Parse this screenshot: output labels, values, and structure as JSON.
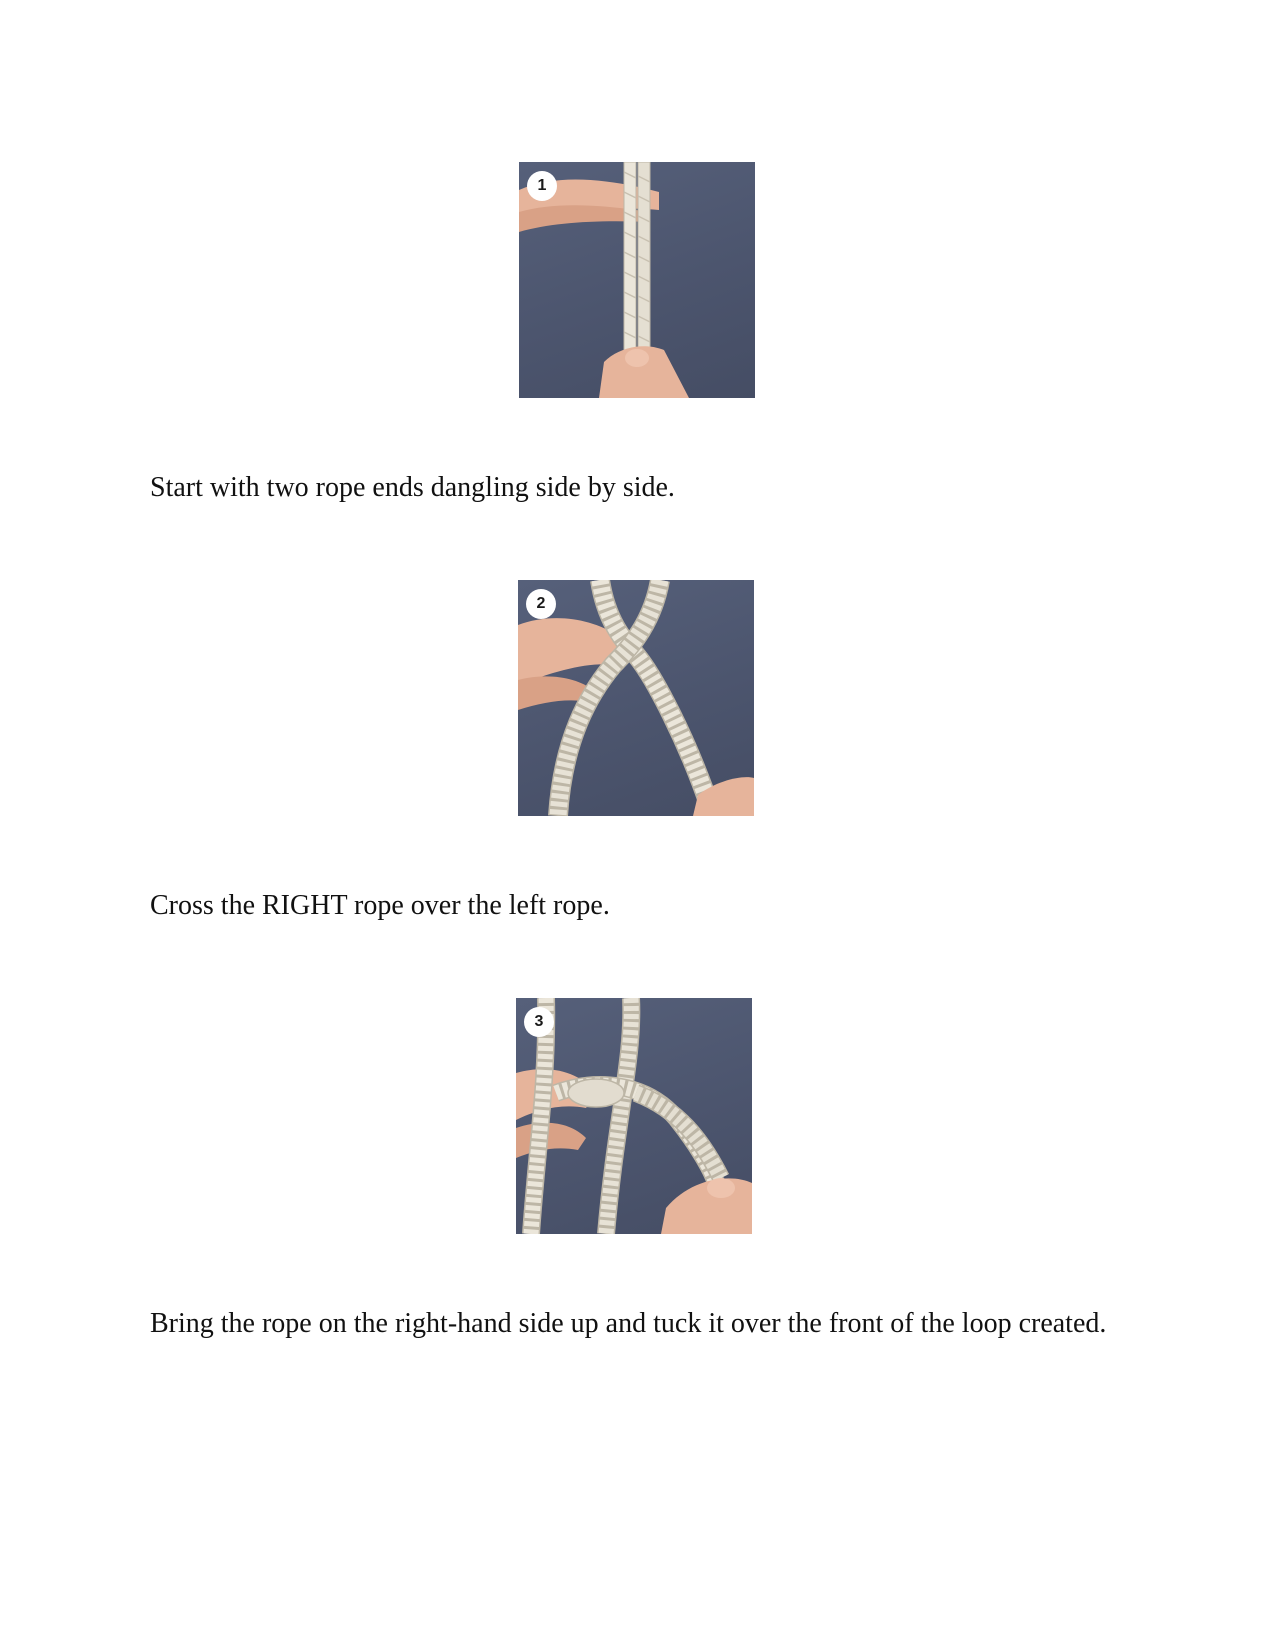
{
  "steps": [
    {
      "number": "1",
      "caption": "Start with two rope ends dangling side by side."
    },
    {
      "number": "2",
      "caption": "Cross the RIGHT rope over the left rope."
    },
    {
      "number": "3",
      "caption": "Bring the rope on the right-hand side up and tuck it over the front of the loop created."
    }
  ],
  "colors": {
    "photo_background": "#4c556e",
    "rope": "#e9e4d8",
    "hand": "#e8b8a0"
  }
}
